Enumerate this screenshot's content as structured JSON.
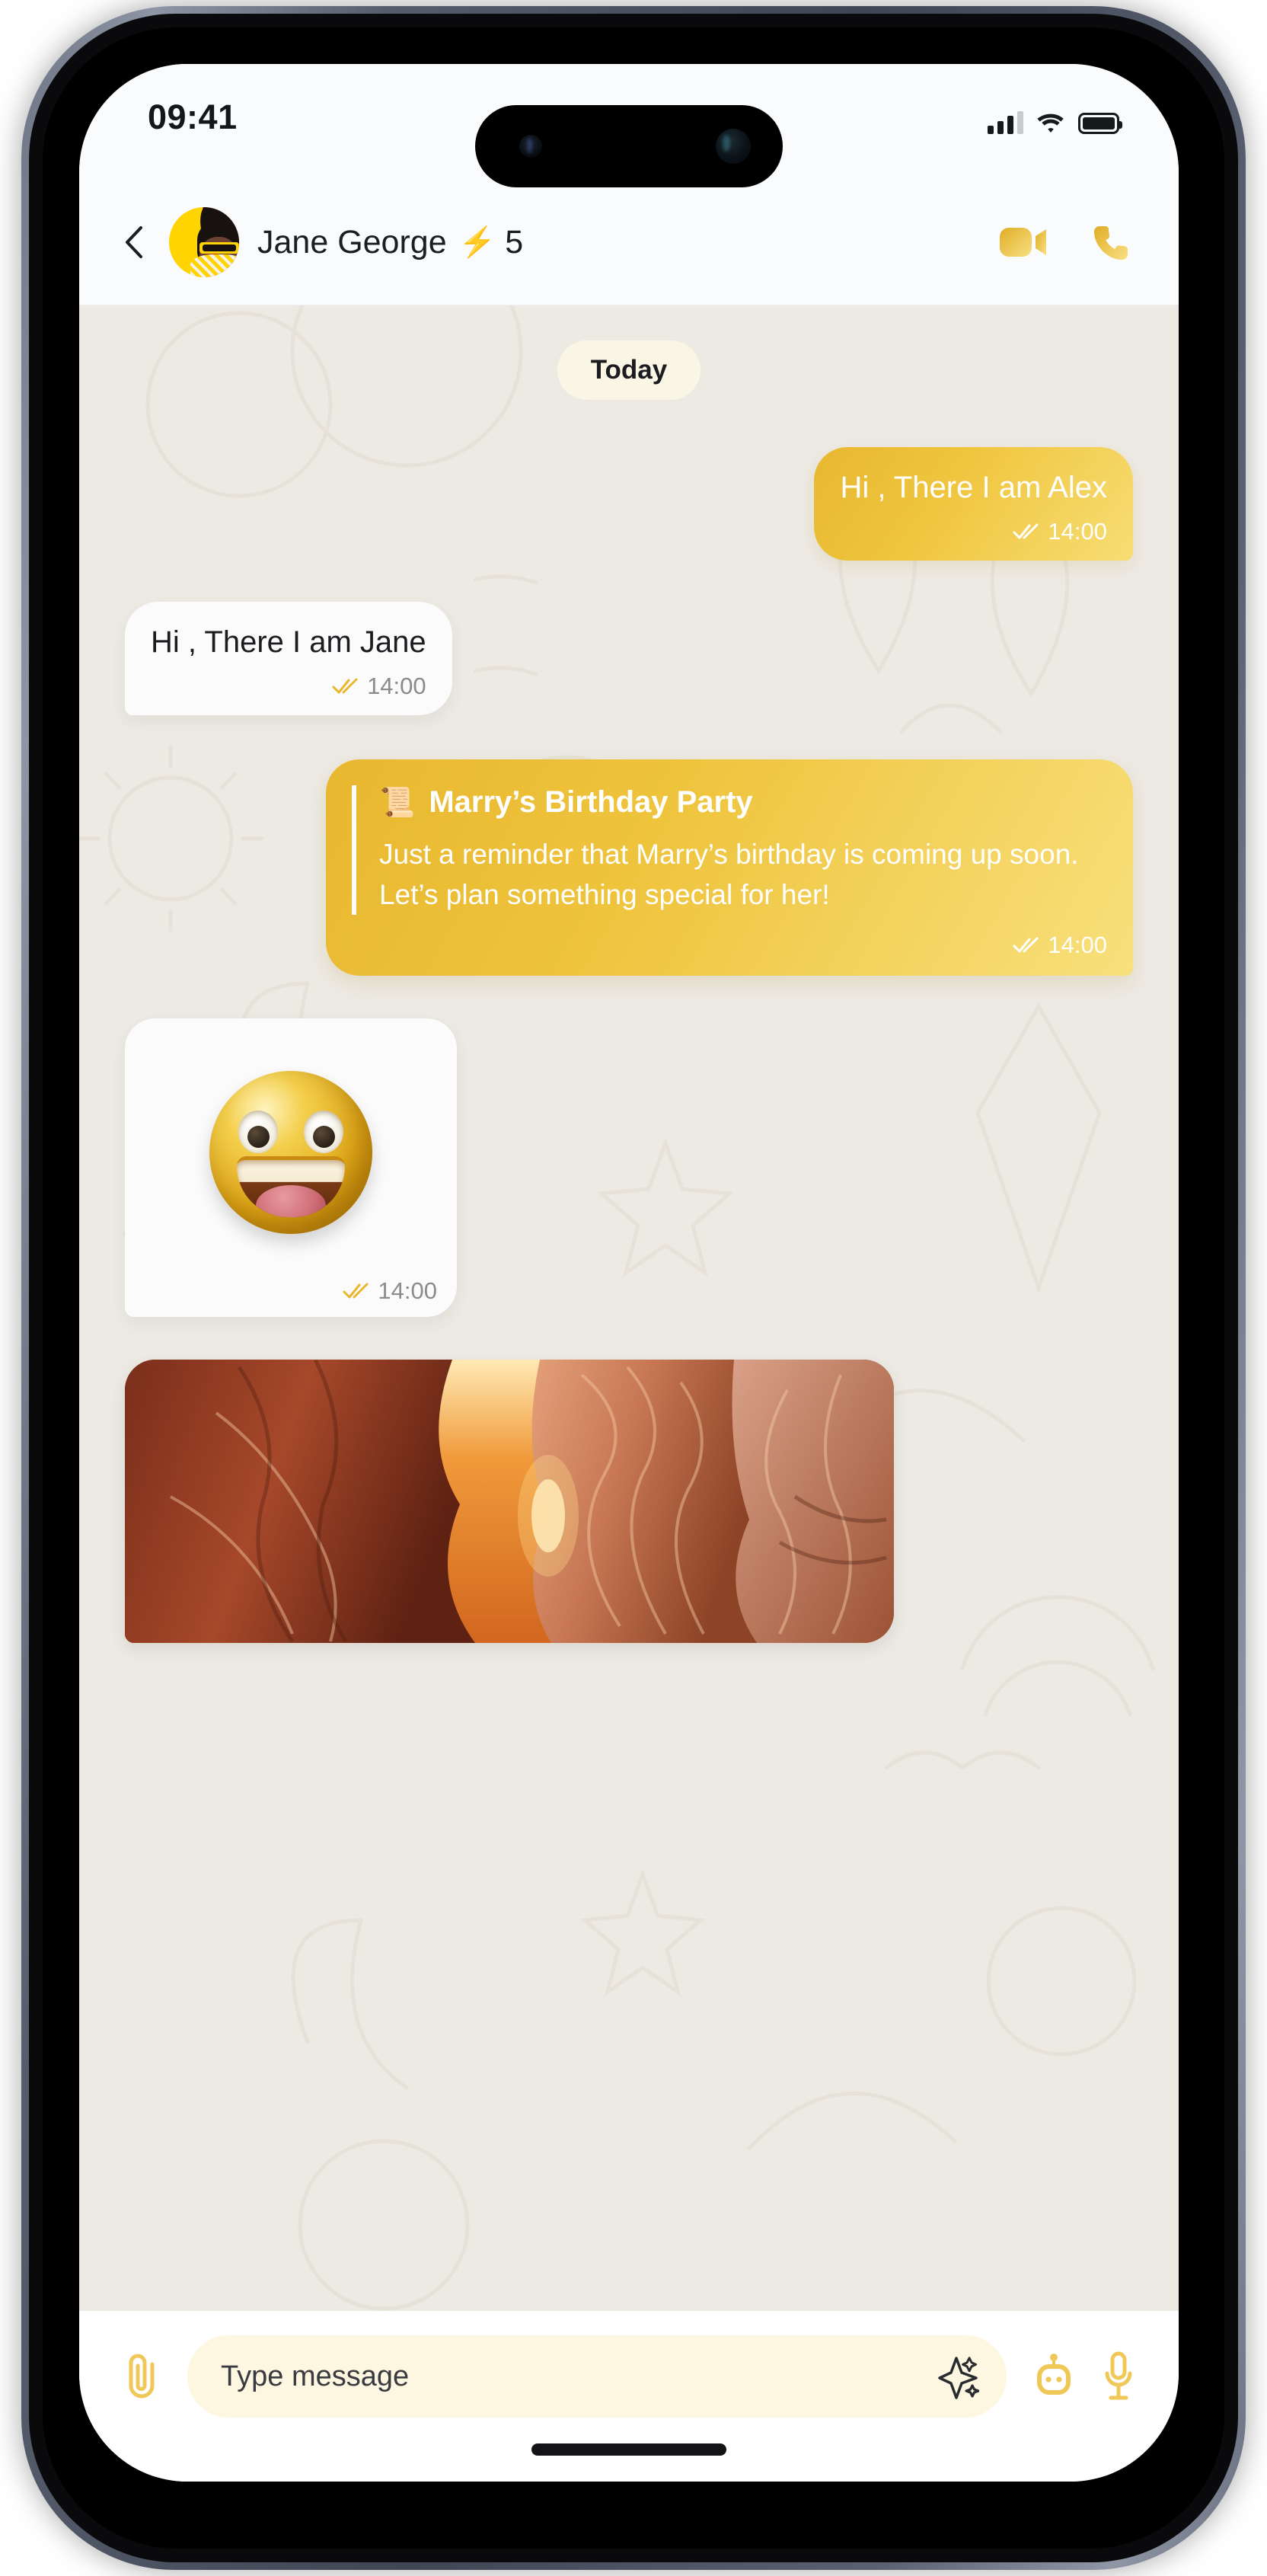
{
  "status_bar": {
    "time": "09:41",
    "signal_icon": "cellular-signal-icon",
    "signal_bars_filled": 3,
    "signal_bars_total": 4,
    "wifi_icon": "wifi-icon",
    "battery_icon": "battery-icon",
    "battery_full": true
  },
  "header": {
    "back_icon": "chevron-left-icon",
    "avatar_alt": "avatar",
    "name": "Jane George",
    "bolt_icon": "⚡",
    "bolt_count": "5",
    "video_call_icon": "video-camera-icon",
    "voice_call_icon": "phone-icon",
    "accent": "#e8b72f"
  },
  "chat": {
    "day_divider": "Today",
    "messages": [
      {
        "kind": "text",
        "direction": "out",
        "text": "Hi , There I am Alex",
        "time": "14:00",
        "ticks": "double-check-icon"
      },
      {
        "kind": "text",
        "direction": "in",
        "text": "Hi , There I am Jane",
        "time": "14:00",
        "ticks": "double-check-icon"
      },
      {
        "kind": "card",
        "direction": "out",
        "icon": "📜",
        "title": "Marry’s Birthday Party",
        "text": "Just a reminder that Marry’s birthday is coming up soon. Let’s plan something special for her!",
        "time": "14:00",
        "ticks": "double-check-icon"
      },
      {
        "kind": "sticker",
        "direction": "in",
        "sticker": "grinning-face-emoji-sticker",
        "time": "14:00",
        "ticks": "double-check-icon"
      },
      {
        "kind": "photo",
        "direction": "in",
        "photo": "slot-canyon-photo"
      }
    ]
  },
  "input_bar": {
    "attach_icon": "paperclip-icon",
    "placeholder": "Type message",
    "value": "",
    "ai_icon": "sparkle-icon",
    "bot_icon": "robot-icon",
    "mic_icon": "microphone-icon"
  },
  "colors": {
    "accent_gold": "#e8b72f",
    "accent_gold_light": "#f7dd74",
    "chat_bg": "#edeae4",
    "bubble_in": "#fbfbfb",
    "field_bg": "#fdf7e2",
    "day_pill_bg": "#faf6e6"
  }
}
